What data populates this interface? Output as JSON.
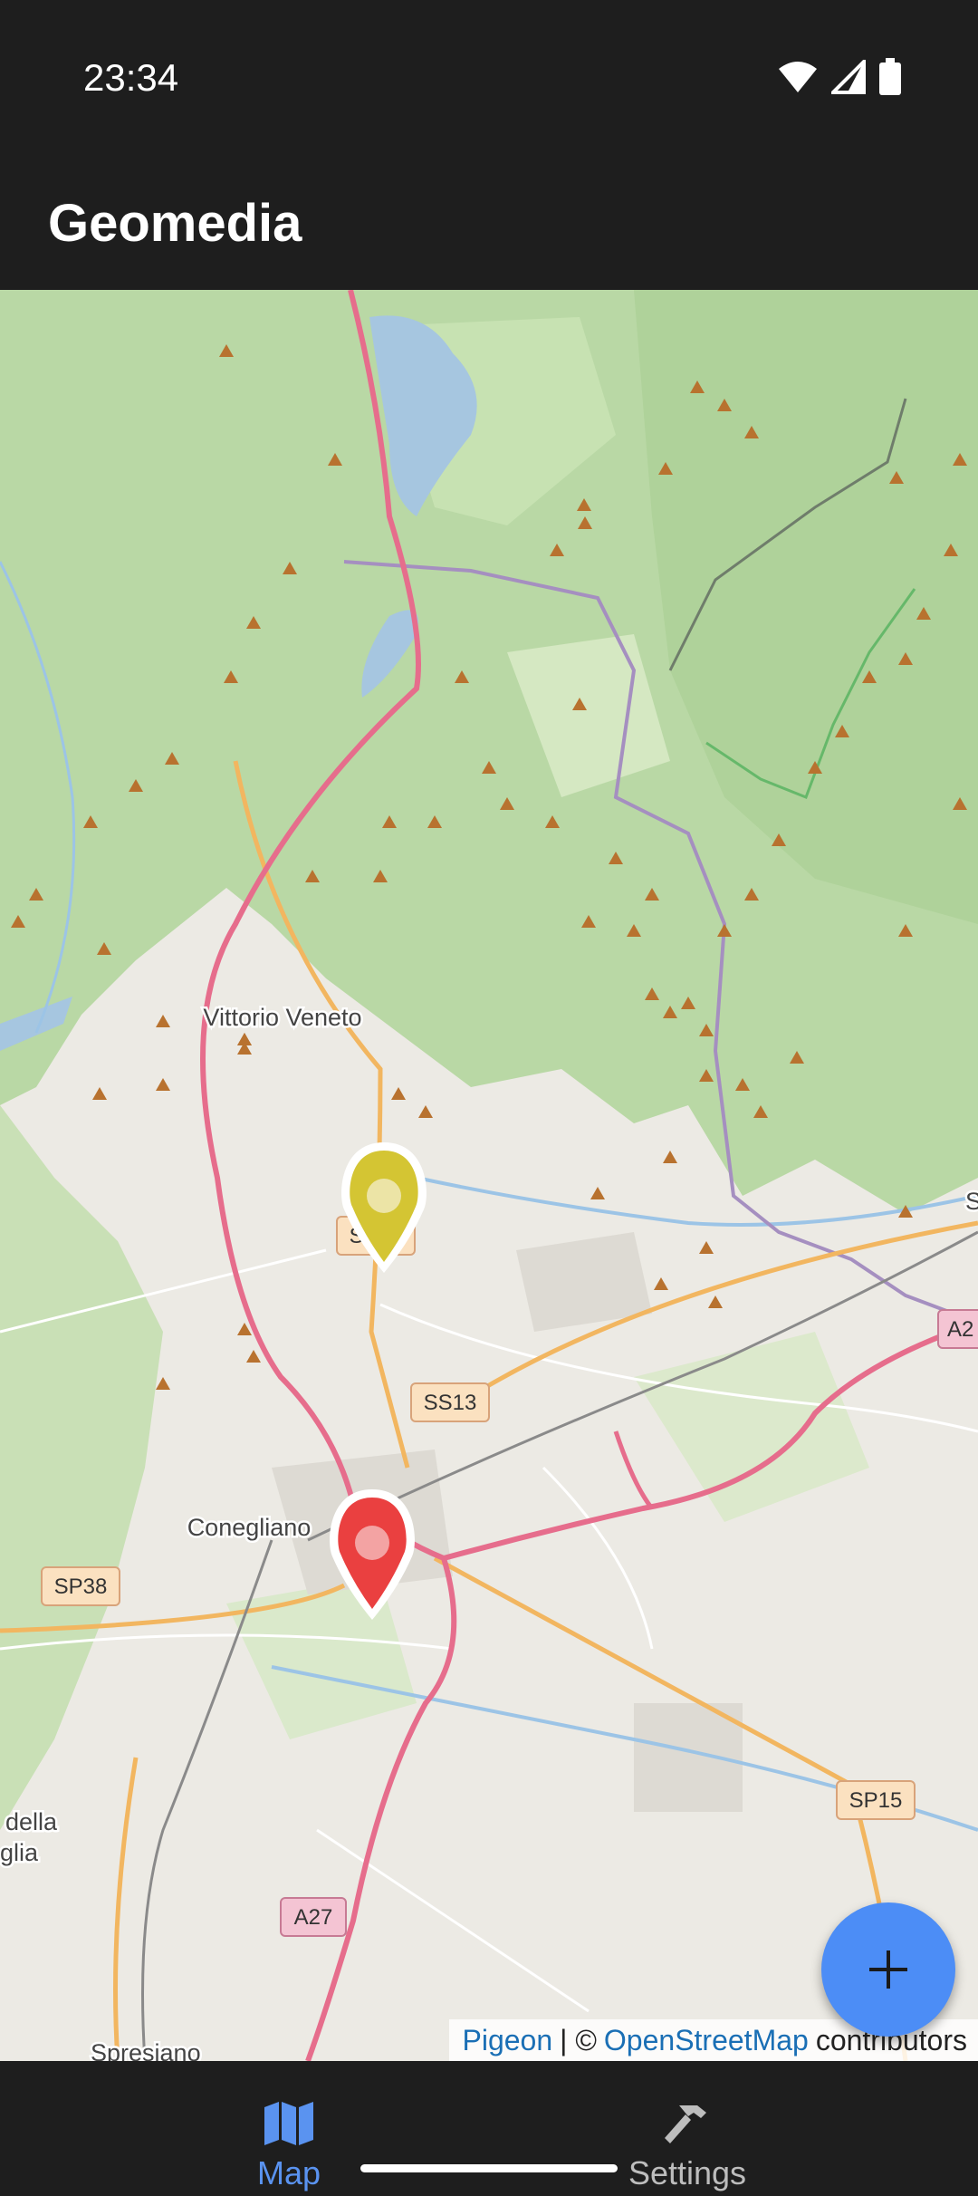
{
  "status_bar": {
    "time": "23:34"
  },
  "app_bar": {
    "title": "Geomedia"
  },
  "map": {
    "place_labels": {
      "vittorio_veneto": "Vittorio Veneto",
      "conegliano": "Conegliano",
      "della": "della",
      "glia": "glia",
      "spresiano": "Spresiano",
      "s_edge": "S"
    },
    "road_labels": {
      "ss51": "SS51",
      "ss13": "SS13",
      "sp38": "SP38",
      "sp15": "SP15",
      "a27": "A27",
      "a2": "A2"
    },
    "markers": [
      {
        "name": "yellow marker",
        "color": "#d4c533"
      },
      {
        "name": "red marker",
        "color": "#ea4040"
      }
    ],
    "attribution": {
      "pigeon": "Pigeon",
      "separator": "| ©",
      "osm": "OpenStreetMap",
      "suffix": "contributors"
    }
  },
  "fab": {
    "icon": "plus-icon",
    "color": "#4c8df6"
  },
  "bottom_nav": {
    "items": [
      {
        "label": "Map",
        "icon": "map-icon",
        "active": true
      },
      {
        "label": "Settings",
        "icon": "hammer-icon",
        "active": false
      }
    ]
  }
}
